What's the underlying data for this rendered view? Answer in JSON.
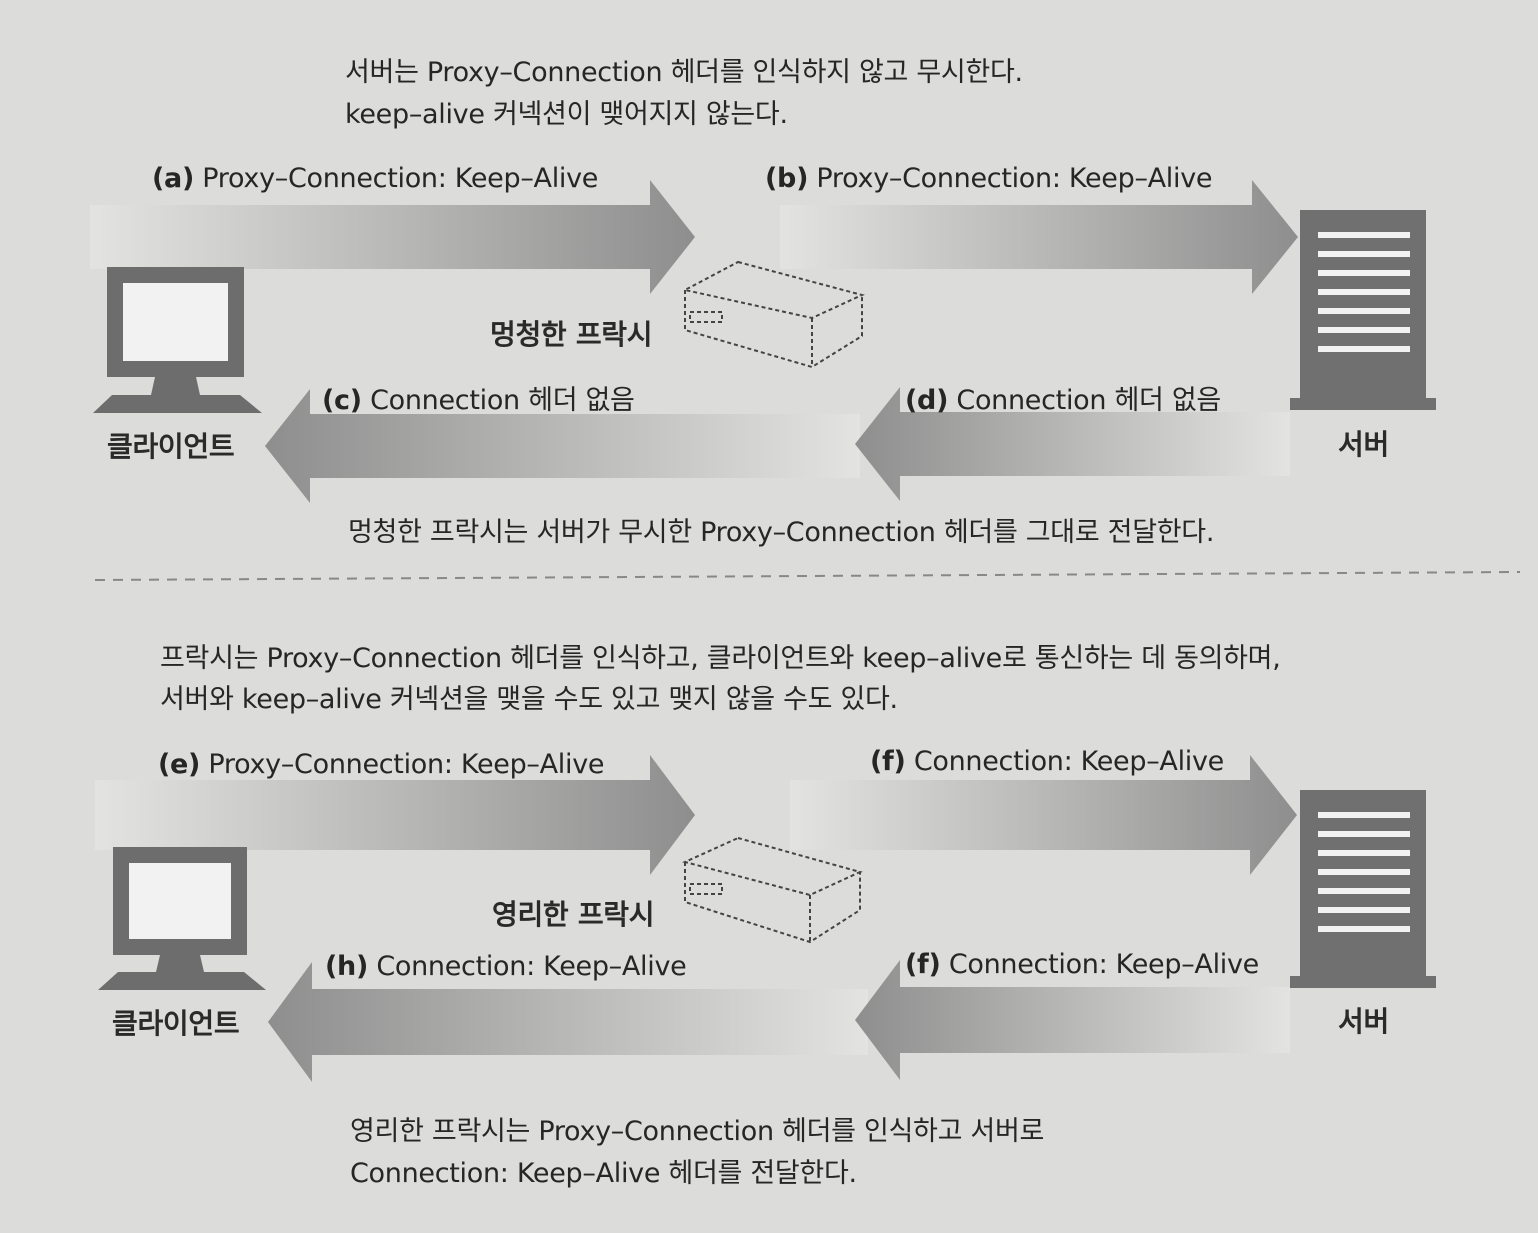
{
  "top": {
    "caption_lines": [
      "서버는 Proxy–Connection 헤더를 인식하지 않고 무시한다.",
      "keep–alive 커넥션이 맺어지지 않는다."
    ],
    "arrows": {
      "a": {
        "id": "(a)",
        "text": "Proxy–Connection: Keep–Alive"
      },
      "b": {
        "id": "(b)",
        "text": "Proxy–Connection: Keep–Alive"
      },
      "c": {
        "id": "(c)",
        "text": "Connection 헤더 없음"
      },
      "d": {
        "id": "(d)",
        "text": "Connection 헤더 없음"
      }
    },
    "client_label": "클라이언트",
    "proxy_label": "멍청한 프락시",
    "server_label": "서버",
    "bottom_caption": "멍청한 프락시는 서버가 무시한 Proxy–Connection 헤더를 그대로 전달한다."
  },
  "bottom": {
    "caption_lines": [
      "프락시는 Proxy–Connection 헤더를 인식하고, 클라이언트와 keep–alive로 통신하는 데 동의하며,",
      "서버와 keep–alive 커넥션을 맺을 수도 있고 맺지 않을 수도 있다."
    ],
    "arrows": {
      "e": {
        "id": "(e)",
        "text": "Proxy–Connection: Keep–Alive"
      },
      "f1": {
        "id": "(f)",
        "text": "Connection: Keep–Alive"
      },
      "f2": {
        "id": "(f)",
        "text": "Connection: Keep–Alive"
      },
      "h": {
        "id": "(h)",
        "text": "Connection: Keep–Alive"
      }
    },
    "client_label": "클라이언트",
    "proxy_label": "영리한 프락시",
    "server_label": "서버",
    "bottom_caption_lines": [
      "영리한 프락시는 Proxy–Connection 헤더를 인식하고 서버로",
      "Connection: Keep–Alive 헤더를 전달한다."
    ]
  },
  "colors": {
    "background": "#dcdcda",
    "arrow_dark": "#8c8c8c",
    "arrow_light": "#e2e2e0",
    "device": "#6f6f6f",
    "text": "#262626"
  }
}
